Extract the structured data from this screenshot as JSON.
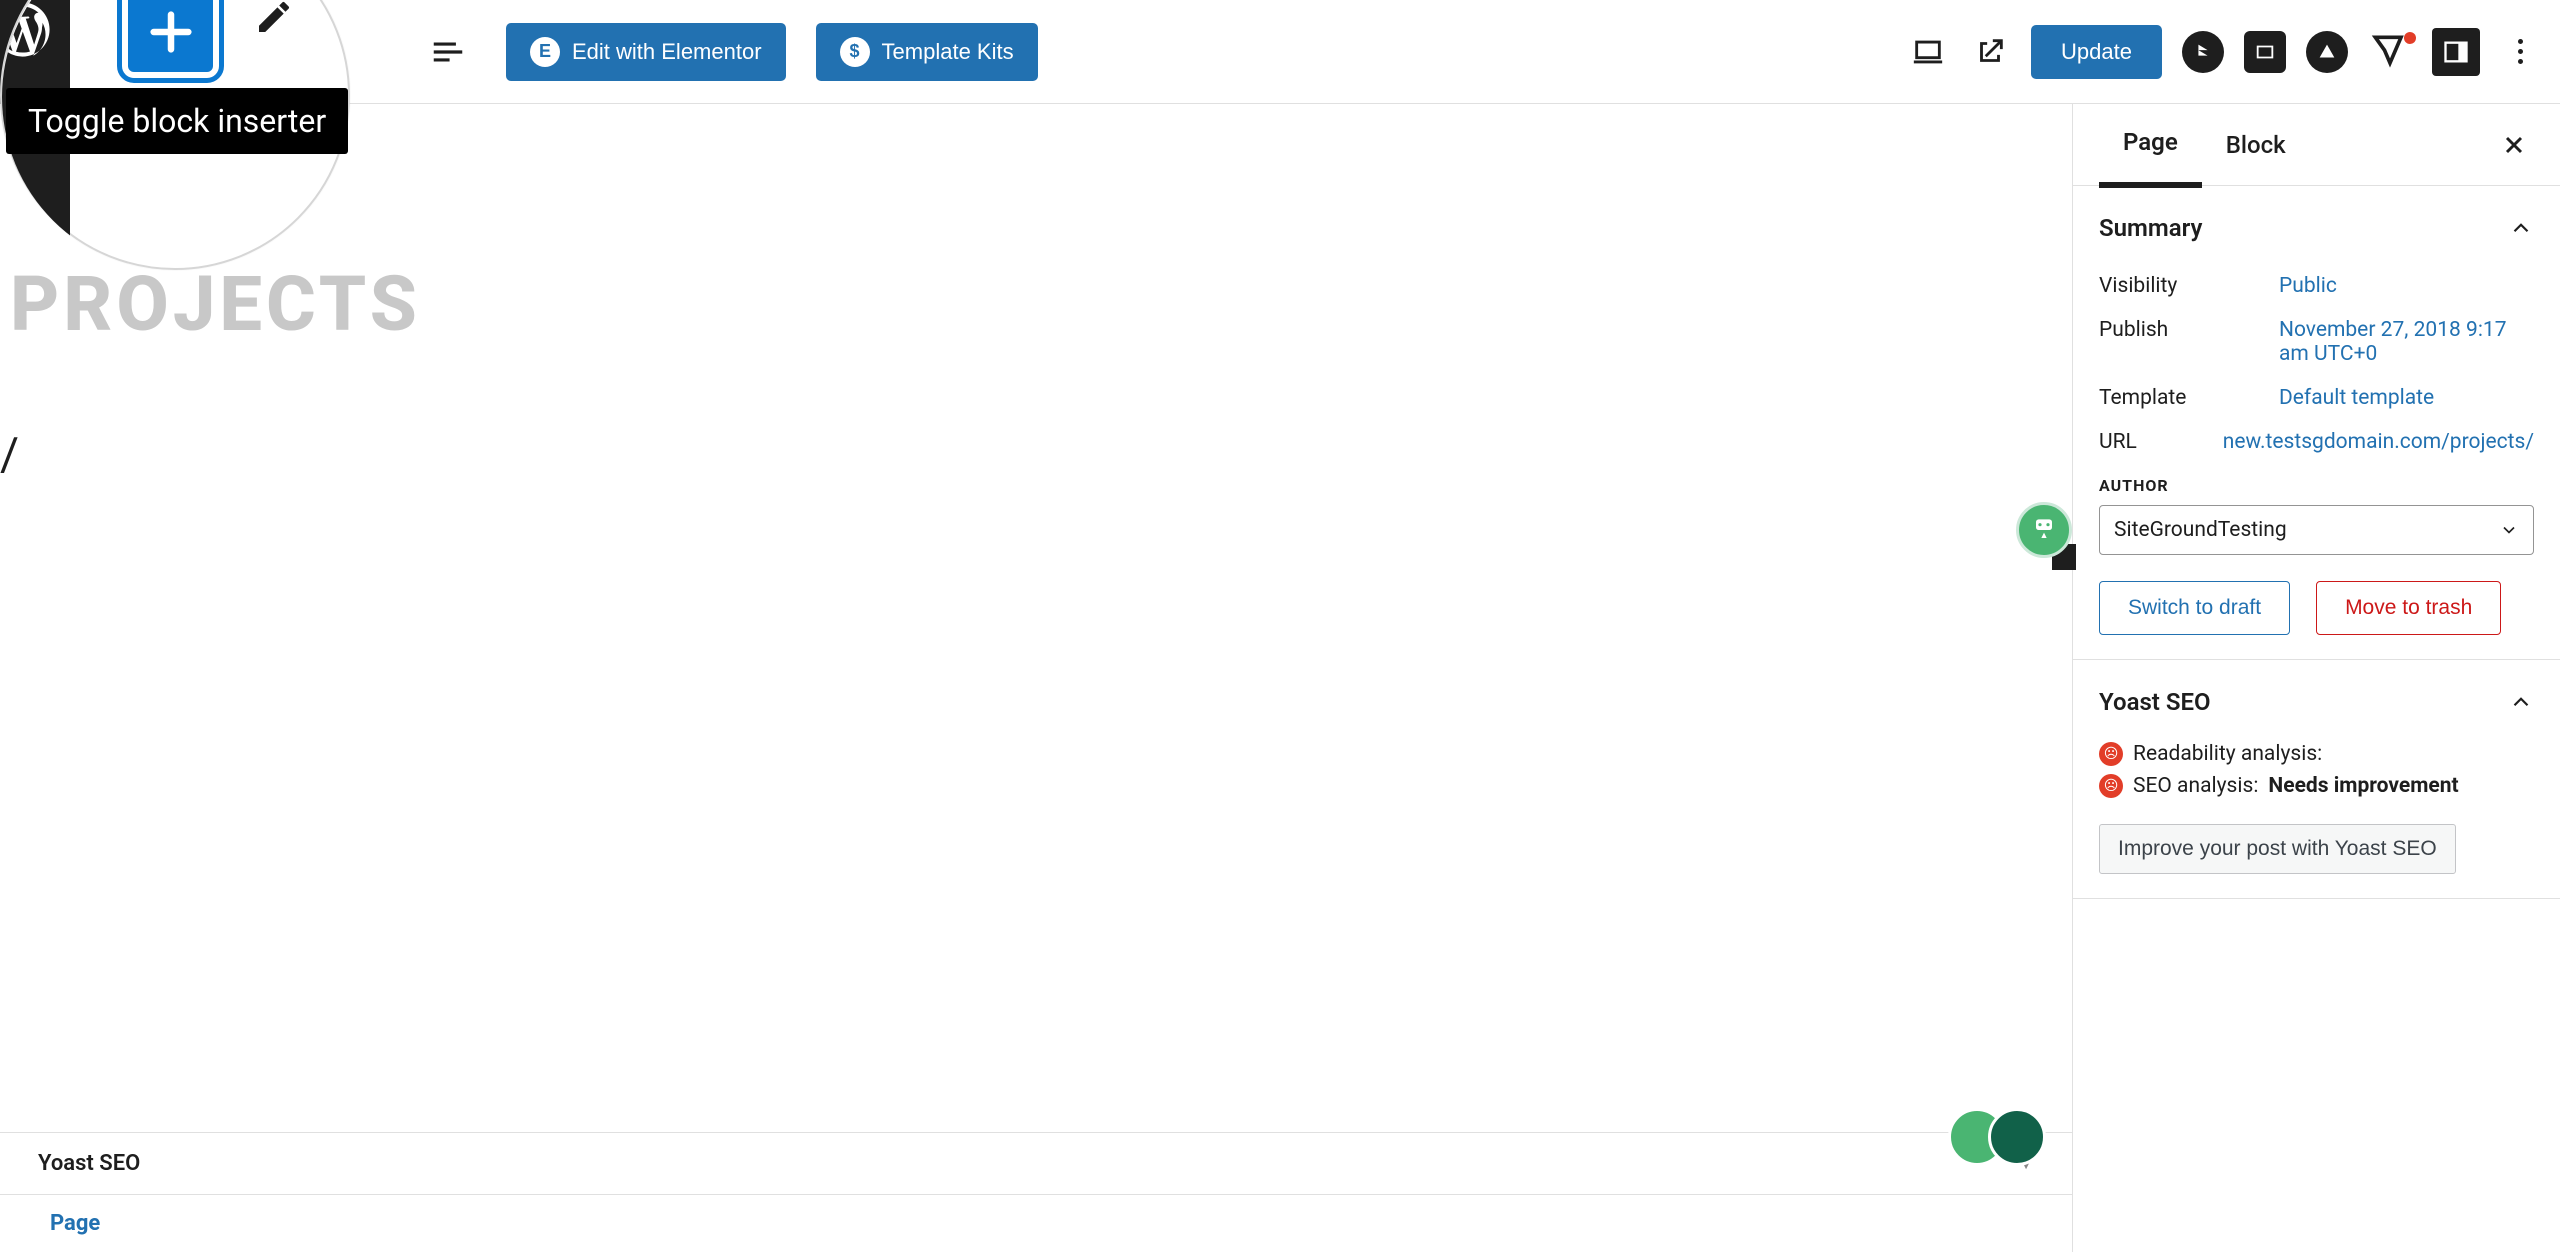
{
  "toolbar": {
    "tooltip": "Toggle block inserter",
    "edit_elementor": "Edit with Elementor",
    "template_kits": "Template Kits",
    "update": "Update"
  },
  "editor": {
    "title": "PROJECTS",
    "slash": "/"
  },
  "bottom": {
    "yoast": "Yoast SEO",
    "page": "Page"
  },
  "sidebar": {
    "tabs": {
      "page": "Page",
      "block": "Block"
    },
    "summary": {
      "heading": "Summary",
      "visibility_label": "Visibility",
      "visibility_value": "Public",
      "publish_label": "Publish",
      "publish_value": "November 27, 2018 9:17 am UTC+0",
      "template_label": "Template",
      "template_value": "Default template",
      "url_label": "URL",
      "url_value": "new.testsgdomain.com/projects/",
      "author_label": "AUTHOR",
      "author_value": "SiteGroundTesting",
      "switch_draft": "Switch to draft",
      "move_trash": "Move to trash"
    },
    "yoast": {
      "heading": "Yoast SEO",
      "readability": "Readability analysis:",
      "seo_label": "SEO analysis: ",
      "seo_value": "Needs improvement",
      "improve": "Improve your post with Yoast SEO"
    }
  }
}
